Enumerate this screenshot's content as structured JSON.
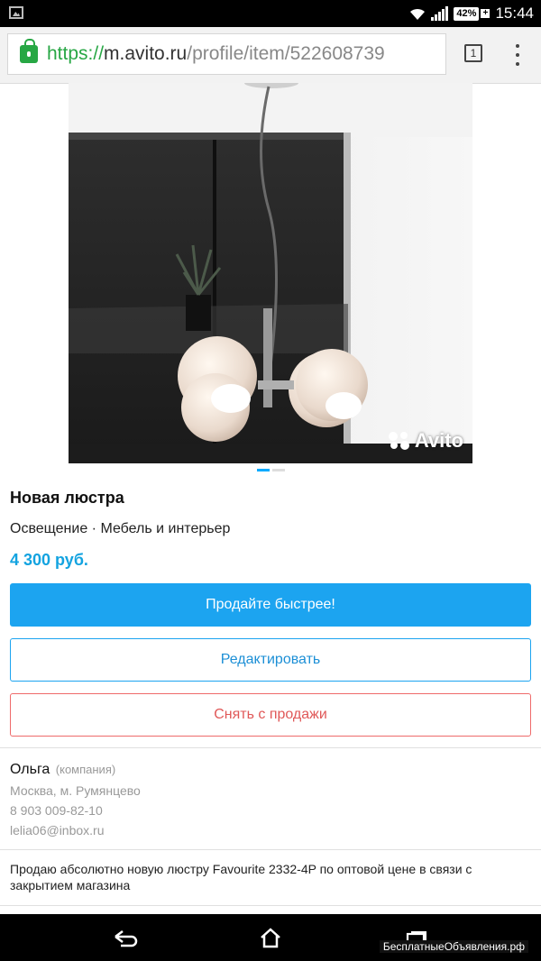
{
  "status_bar": {
    "battery_percent": "42%",
    "time": "15:44"
  },
  "browser": {
    "url_scheme": "https://",
    "url_host": "m.avito.ru",
    "url_path": "/profile/item/522608739",
    "tab_count": "1"
  },
  "listing": {
    "image_watermark": "Avito",
    "title": "Новая люстра",
    "category": "Освещение · Мебель и интерьер",
    "price": "4 300 руб.",
    "image_index": 1,
    "image_count": 2
  },
  "actions": {
    "sell_faster": "Продайте быстрее!",
    "edit": "Редактировать",
    "remove": "Снять с продажи"
  },
  "seller": {
    "name": "Ольга",
    "type": "(компания)",
    "location": "Москва, м. Румянцево",
    "phone": "8 903 009-82-10",
    "email": "lelia06@inbox.ru"
  },
  "description": "Продаю абсолютно новую люстру Favourite 2332-4P по оптовой цене в связи с закрытием магазина",
  "site_mark": "БесплатныеОбъявления.рф",
  "colors": {
    "accent": "#1ca4f0",
    "price": "#13a3e0",
    "danger": "#e05858",
    "ssl_green": "#27a744"
  }
}
